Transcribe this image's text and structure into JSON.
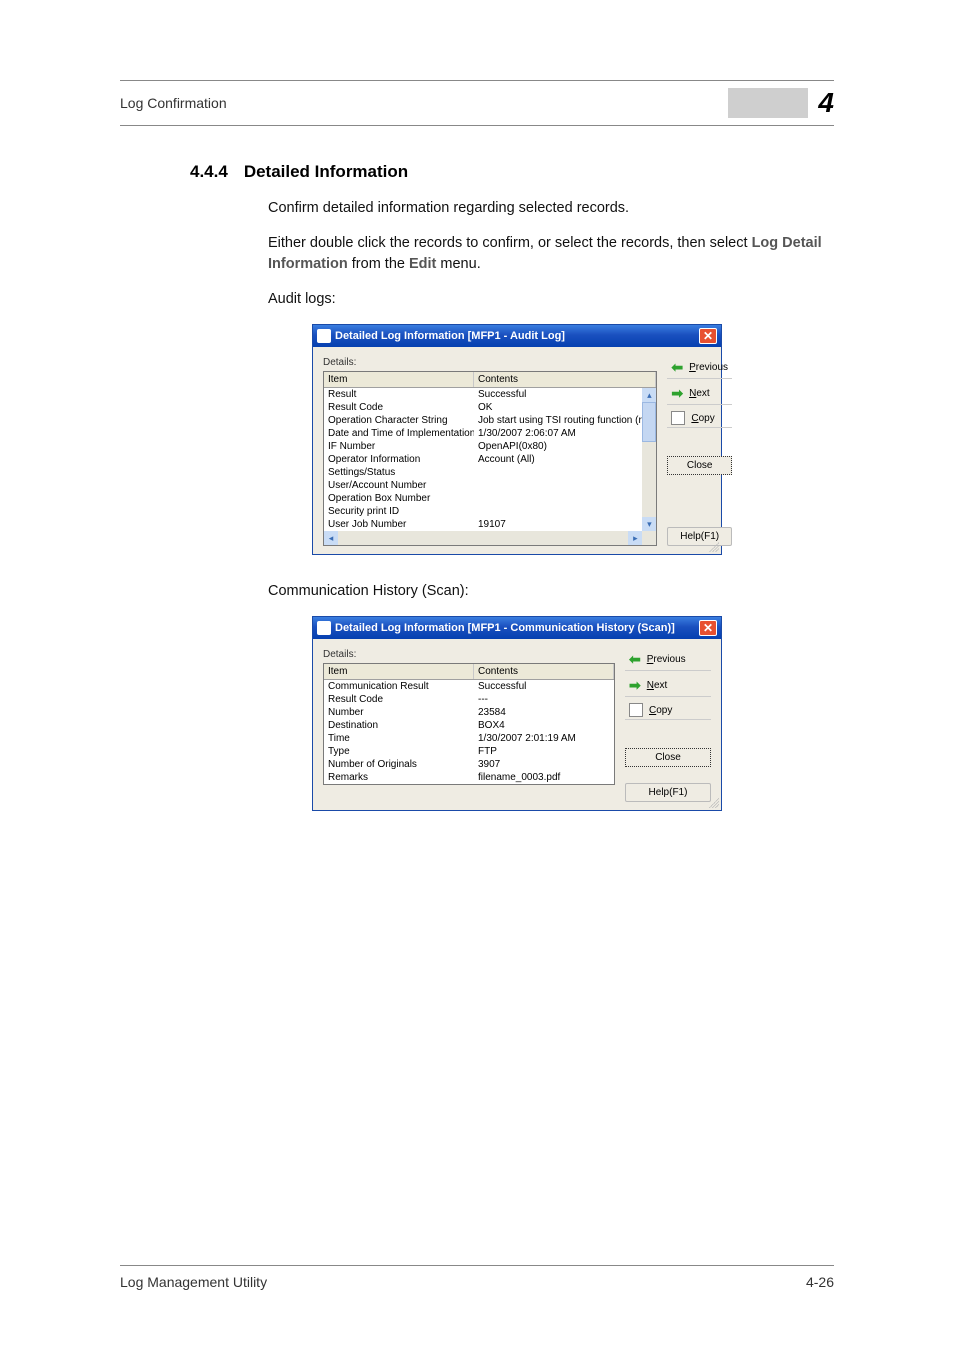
{
  "header": {
    "left": "Log Confirmation",
    "chapter": "4"
  },
  "section": {
    "number": "4.4.4",
    "title": "Detailed Information",
    "para1": "Confirm detailed information regarding selected records.",
    "para2_prefix": "Either double click the records to confirm, or select the records, then select ",
    "para2_bold1": "Log Detail Information",
    "para2_mid": " from the ",
    "para2_bold2": "Edit",
    "para2_suffix": " menu.",
    "audit_label": "Audit logs:",
    "comm_label": "Communication History (Scan):"
  },
  "dialog_common": {
    "details": "Details:",
    "col_item": "Item",
    "col_contents": "Contents",
    "previous": "Previous",
    "next": "Next",
    "copy": "Copy",
    "close": "Close",
    "help": "Help(F1)"
  },
  "dialog1": {
    "title": "Detailed Log Information [MFP1 - Audit Log]",
    "rows": [
      {
        "item": "Result",
        "content": "Successful"
      },
      {
        "item": "Result Code",
        "content": "OK"
      },
      {
        "item": "Operation Character String",
        "content": "Job start using TSI routing function (rec"
      },
      {
        "item": "Date and Time of Implementation",
        "content": "1/30/2007 2:06:07 AM"
      },
      {
        "item": "IF Number",
        "content": "OpenAPI(0x80)"
      },
      {
        "item": "Operator Information",
        "content": "Account   (All)"
      },
      {
        "item": "Settings/Status",
        "content": ""
      },
      {
        "item": "User/Account Number",
        "content": ""
      },
      {
        "item": "Operation Box Number",
        "content": ""
      },
      {
        "item": "Security print ID",
        "content": ""
      },
      {
        "item": "User Job Number",
        "content": "19107"
      }
    ]
  },
  "dialog2": {
    "title": "Detailed Log Information [MFP1 - Communication History (Scan)]",
    "rows": [
      {
        "item": "Communication Result",
        "content": "Successful"
      },
      {
        "item": "Result Code",
        "content": "---"
      },
      {
        "item": "Number",
        "content": "23584"
      },
      {
        "item": "Destination",
        "content": "BOX4"
      },
      {
        "item": "Time",
        "content": "1/30/2007 2:01:19 AM"
      },
      {
        "item": "Type",
        "content": "FTP"
      },
      {
        "item": "Number of Originals",
        "content": "3907"
      },
      {
        "item": "Remarks",
        "content": "filename_0003.pdf"
      },
      {
        "item": "",
        "content": ""
      },
      {
        "item": "",
        "content": ""
      },
      {
        "item": "",
        "content": ""
      }
    ]
  },
  "footer": {
    "left": "Log Management Utility",
    "right": "4-26"
  }
}
